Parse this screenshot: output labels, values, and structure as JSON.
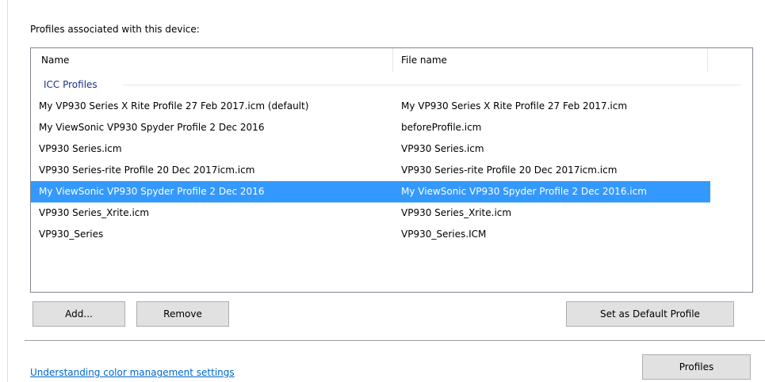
{
  "section_label": "Profiles associated with this device:",
  "list": {
    "columns": {
      "name": "Name",
      "file": "File name"
    },
    "group_label": "ICC Profiles",
    "rows": [
      {
        "name": "My VP930 Series X Rite Profile 27 Feb 2017.icm (default)",
        "file": "My VP930 Series X Rite Profile 27 Feb 2017.icm",
        "selected": false
      },
      {
        "name": "My ViewSonic VP930 Spyder Profile 2 Dec 2016",
        "file": "beforeProfile.icm",
        "selected": false
      },
      {
        "name": "VP930 Series.icm",
        "file": "VP930 Series.icm",
        "selected": false
      },
      {
        "name": "VP930 Series-rite Profile 20 Dec 2017icm.icm",
        "file": "VP930 Series-rite Profile 20 Dec 2017icm.icm",
        "selected": false
      },
      {
        "name": "My ViewSonic VP930 Spyder Profile 2 Dec 2016",
        "file": "My ViewSonic VP930 Spyder Profile 2 Dec 2016.icm",
        "selected": true
      },
      {
        "name": "VP930 Series_Xrite.icm",
        "file": "VP930 Series_Xrite.icm",
        "selected": false
      },
      {
        "name": "VP930_Series",
        "file": "VP930_Series.ICM",
        "selected": false
      }
    ]
  },
  "buttons": {
    "add": "Add...",
    "remove": "Remove",
    "set_default": "Set as Default Profile",
    "profiles": "Profiles"
  },
  "help_link": "Understanding color management settings",
  "colors": {
    "selection": "#3399ff",
    "group_text": "#1e3287",
    "link": "#0066cc"
  }
}
